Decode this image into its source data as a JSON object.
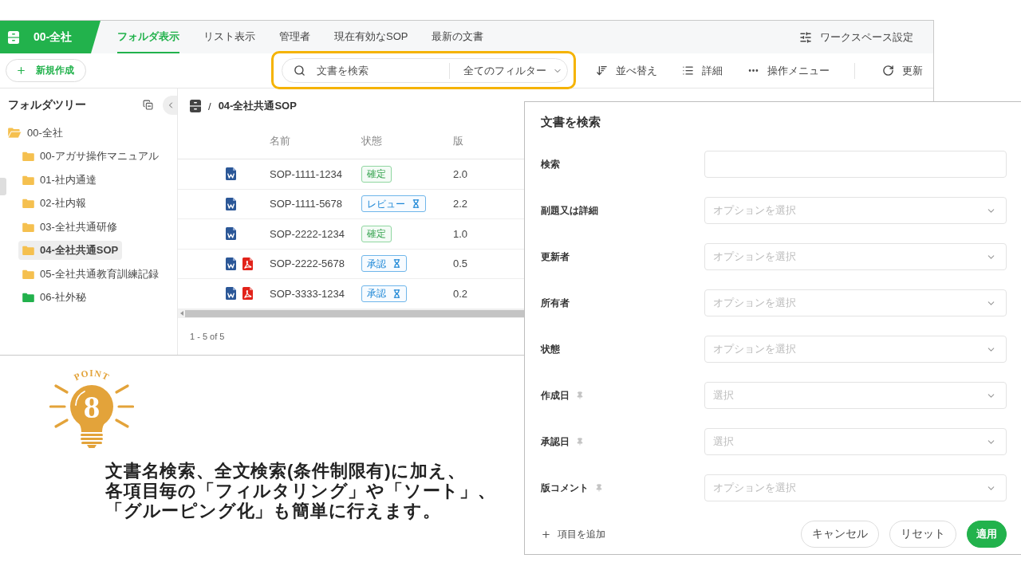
{
  "header": {
    "workspace": "00-全社",
    "tabs": [
      {
        "label": "フォルダ表示",
        "selected": true
      },
      {
        "label": "リスト表示",
        "selected": false
      },
      {
        "label": "管理者",
        "selected": false
      },
      {
        "label": "現在有効なSOP",
        "selected": false
      },
      {
        "label": "最新の文書",
        "selected": false
      }
    ],
    "settings": "ワークスペース設定"
  },
  "toolbar": {
    "new_button": "新規作成",
    "search": {
      "placeholder": "文書を検索",
      "filter": "全てのフィルター",
      "highlighted": true
    },
    "actions": [
      {
        "kind": "sort",
        "label": "並べ替え"
      },
      {
        "kind": "details",
        "label": "詳細"
      },
      {
        "kind": "menu",
        "label": "操作メニュー"
      },
      {
        "kind": "refresh",
        "label": "更新"
      }
    ]
  },
  "folder_tree": {
    "title": "フォルダツリー",
    "items": [
      {
        "label": "00-全社",
        "color": "#f5c04f",
        "expanded": true,
        "selected": false,
        "children": [
          {
            "label": "00-アガサ操作マニュアル",
            "color": "#f5c04f",
            "expanded": false,
            "selected": false
          },
          {
            "label": "01-社内通達",
            "color": "#f5c04f",
            "expanded": false,
            "selected": false
          },
          {
            "label": "02-社内報",
            "color": "#f5c04f",
            "expanded": false,
            "selected": false
          },
          {
            "label": "03-全社共通研修",
            "color": "#f5c04f",
            "expanded": false,
            "selected": false
          },
          {
            "label": "04-全社共通SOP",
            "color": "#f5c04f",
            "expanded": false,
            "selected": true
          },
          {
            "label": "05-全社共通教育訓練記録",
            "color": "#f5c04f",
            "expanded": false,
            "selected": false
          },
          {
            "label": "06-社外秘",
            "color": "#22b14c",
            "expanded": false,
            "selected": false
          }
        ]
      }
    ]
  },
  "breadcrumb": {
    "separator": "/",
    "current": "04-全社共通SOP"
  },
  "table": {
    "columns": [
      "名前",
      "状態",
      "版"
    ],
    "rows": [
      {
        "files": [
          {
            "kind": "word"
          }
        ],
        "name": "SOP-1111-1234",
        "status": {
          "label": "確定",
          "kind": "confirmed"
        },
        "version": "2.0"
      },
      {
        "files": [
          {
            "kind": "word"
          }
        ],
        "name": "SOP-1111-5678",
        "status": {
          "label": "レビュー",
          "kind": "pending"
        },
        "version": "2.2"
      },
      {
        "files": [
          {
            "kind": "word"
          }
        ],
        "name": "SOP-2222-1234",
        "status": {
          "label": "確定",
          "kind": "confirmed"
        },
        "version": "1.0"
      },
      {
        "files": [
          {
            "kind": "word"
          },
          {
            "kind": "pdf"
          }
        ],
        "name": "SOP-2222-5678",
        "status": {
          "label": "承認",
          "kind": "pending"
        },
        "version": "0.5"
      },
      {
        "files": [
          {
            "kind": "word"
          },
          {
            "kind": "pdf"
          }
        ],
        "name": "SOP-3333-1234",
        "status": {
          "label": "承認",
          "kind": "pending"
        },
        "version": "0.2"
      }
    ]
  },
  "pagination": "1 - 5 of 5",
  "search_dialog": {
    "title": "文書を検索",
    "fields": [
      {
        "label": "検索",
        "kind": "text",
        "pinned": false
      },
      {
        "label": "副題又は詳細",
        "kind": "select",
        "placeholder": "オプションを選択",
        "pinned": false
      },
      {
        "label": "更新者",
        "kind": "select",
        "placeholder": "オプションを選択",
        "pinned": false
      },
      {
        "label": "所有者",
        "kind": "select",
        "placeholder": "オプションを選択",
        "pinned": false
      },
      {
        "label": "状態",
        "kind": "select",
        "placeholder": "オプションを選択",
        "pinned": false
      },
      {
        "label": "作成日",
        "kind": "select",
        "placeholder": "選択",
        "pinned": true
      },
      {
        "label": "承認日",
        "kind": "select",
        "placeholder": "選択",
        "pinned": true
      },
      {
        "label": "版コメント",
        "kind": "select",
        "placeholder": "オプションを選択",
        "pinned": true
      }
    ],
    "add_field": "項目を追加",
    "buttons": [
      {
        "label": "キャンセル",
        "kind": "secondary"
      },
      {
        "label": "リセット",
        "kind": "secondary"
      },
      {
        "label": "適用",
        "kind": "primary"
      }
    ]
  },
  "point": {
    "badge": "POINT",
    "number": "8",
    "lines": [
      "文書名検索、全文検索(条件制限有)に加え、",
      "各項目毎の「フィルタリング」や「ソート」、",
      "「グルーピング化」も簡単に行えます。"
    ]
  }
}
